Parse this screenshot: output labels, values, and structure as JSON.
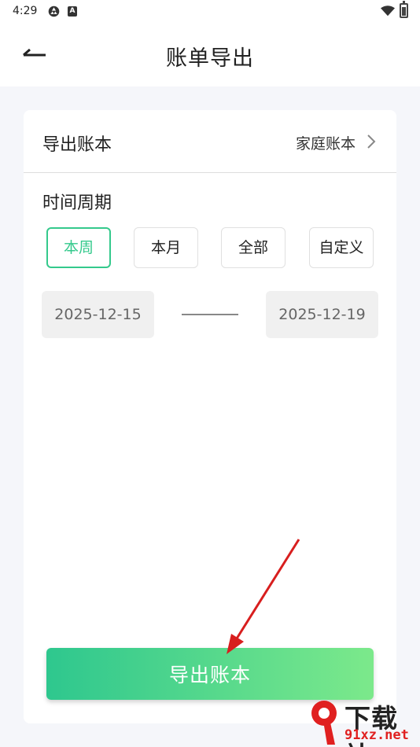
{
  "status_bar": {
    "time": "4:29",
    "app_badge": "A"
  },
  "header": {
    "title": "账单导出"
  },
  "book_row": {
    "label": "导出账本",
    "value": "家庭账本"
  },
  "period": {
    "label": "时间周期",
    "options": [
      "本周",
      "本月",
      "全部",
      "自定义"
    ],
    "selected": "本周"
  },
  "date_range": {
    "start": "2025-12-15",
    "end": "2025-12-19"
  },
  "export_button": {
    "label": "导出账本"
  },
  "watermark": {
    "title": "下载站",
    "site": "91xz.net"
  },
  "colors": {
    "accent": "#34c98c",
    "gradient_start": "#2ec78e",
    "gradient_end": "#7ce98b",
    "arrow": "#d81e1e"
  }
}
